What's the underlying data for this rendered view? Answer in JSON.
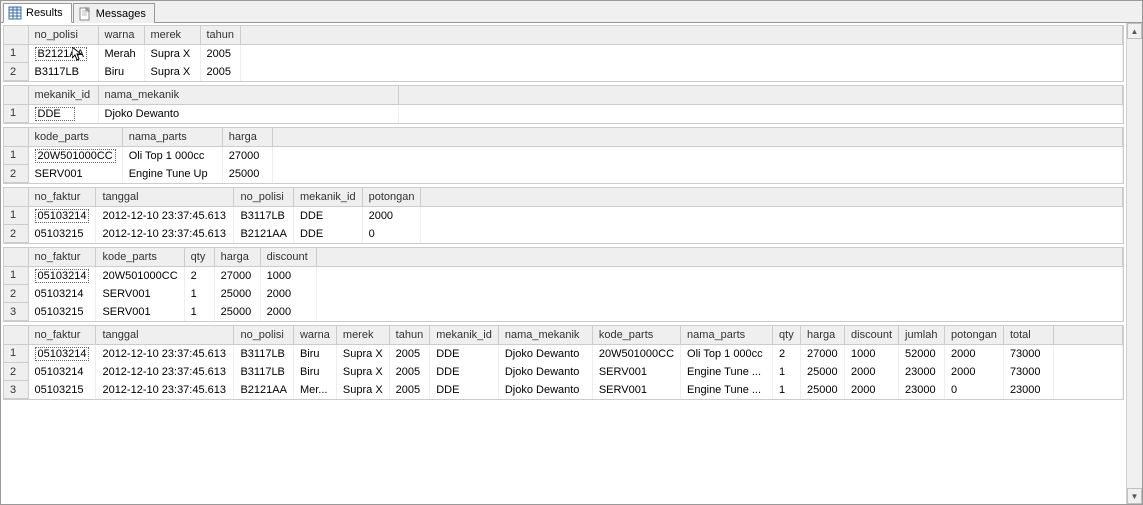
{
  "tabs": {
    "results": "Results",
    "messages": "Messages"
  },
  "grid1": {
    "headers": [
      "no_polisi",
      "warna",
      "merek",
      "tahun"
    ],
    "rows": [
      [
        "B2121AA",
        "Merah",
        "Supra X",
        "2005"
      ],
      [
        "B3117LB",
        "Biru",
        "Supra X",
        "2005"
      ]
    ]
  },
  "grid2": {
    "headers": [
      "mekanik_id",
      "nama_mekanik"
    ],
    "rows": [
      [
        "DDE",
        "Djoko Dewanto"
      ]
    ]
  },
  "grid3": {
    "headers": [
      "kode_parts",
      "nama_parts",
      "harga"
    ],
    "rows": [
      [
        "20W501000CC",
        "Oli Top 1 000cc",
        "27000"
      ],
      [
        "SERV001",
        "Engine Tune Up",
        "25000"
      ]
    ]
  },
  "grid4": {
    "headers": [
      "no_faktur",
      "tanggal",
      "no_polisi",
      "mekanik_id",
      "potongan"
    ],
    "rows": [
      [
        "05103214",
        "2012-12-10 23:37:45.613",
        "B3117LB",
        "DDE",
        "2000"
      ],
      [
        "05103215",
        "2012-12-10 23:37:45.613",
        "B2121AA",
        "DDE",
        "0"
      ]
    ]
  },
  "grid5": {
    "headers": [
      "no_faktur",
      "kode_parts",
      "qty",
      "harga",
      "discount"
    ],
    "rows": [
      [
        "05103214",
        "20W501000CC",
        "2",
        "27000",
        "1000"
      ],
      [
        "05103214",
        "SERV001",
        "1",
        "25000",
        "2000"
      ],
      [
        "05103215",
        "SERV001",
        "1",
        "25000",
        "2000"
      ]
    ]
  },
  "grid6": {
    "headers": [
      "no_faktur",
      "tanggal",
      "no_polisi",
      "warna",
      "merek",
      "tahun",
      "mekanik_id",
      "nama_mekanik",
      "kode_parts",
      "nama_parts",
      "qty",
      "harga",
      "discount",
      "jumlah",
      "potongan",
      "total"
    ],
    "rows": [
      [
        "05103214",
        "2012-12-10 23:37:45.613",
        "B3117LB",
        "Biru",
        "Supra X",
        "2005",
        "DDE",
        "Djoko Dewanto",
        "20W501000CC",
        "Oli Top 1 000cc",
        "2",
        "27000",
        "1000",
        "52000",
        "2000",
        "73000"
      ],
      [
        "05103214",
        "2012-12-10 23:37:45.613",
        "B3117LB",
        "Biru",
        "Supra X",
        "2005",
        "DDE",
        "Djoko Dewanto",
        "SERV001",
        "Engine Tune ...",
        "1",
        "25000",
        "2000",
        "23000",
        "2000",
        "73000"
      ],
      [
        "05103215",
        "2012-12-10 23:37:45.613",
        "B2121AA",
        "Mer...",
        "Supra X",
        "2005",
        "DDE",
        "Djoko Dewanto",
        "SERV001",
        "Engine Tune ...",
        "1",
        "25000",
        "2000",
        "23000",
        "0",
        "23000"
      ]
    ]
  },
  "col_widths": {
    "grid1": [
      70,
      46,
      56,
      40
    ],
    "grid2": [
      70,
      300
    ],
    "grid3": [
      88,
      100,
      50
    ],
    "grid4": [
      66,
      138,
      56,
      62,
      56
    ],
    "grid5": [
      66,
      88,
      30,
      46,
      56
    ],
    "grid6": [
      66,
      138,
      56,
      42,
      52,
      40,
      66,
      94,
      88,
      92,
      28,
      44,
      54,
      46,
      56,
      50
    ]
  }
}
